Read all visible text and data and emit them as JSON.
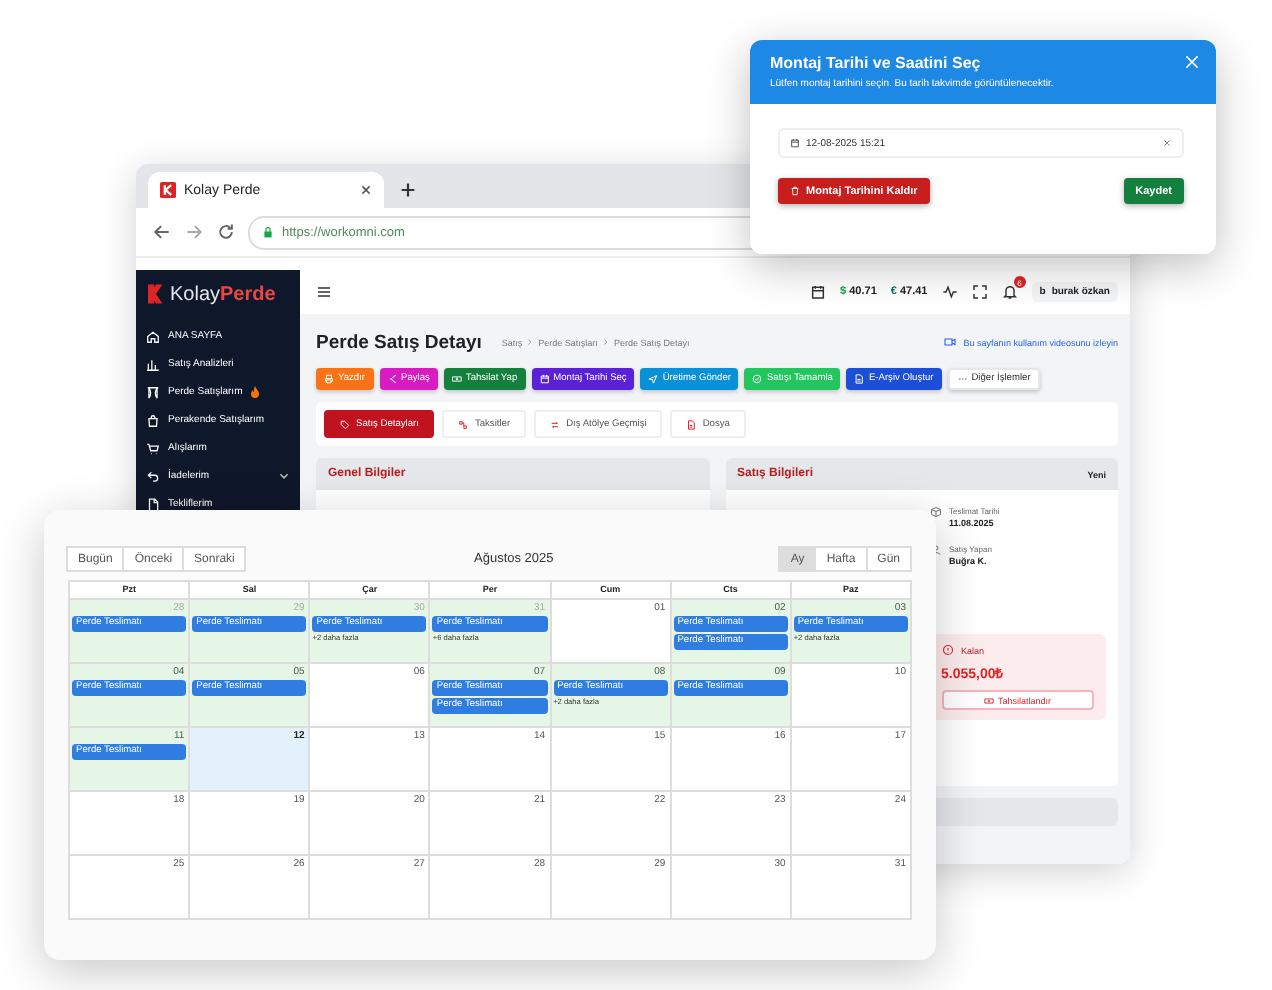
{
  "browser": {
    "tab_title": "Kolay Perde",
    "url": "https://workomni.com"
  },
  "app": {
    "logo": {
      "first": "Kolay",
      "second": "Perde"
    },
    "sidebar": [
      {
        "label": "ANA SAYFA",
        "hot": false,
        "expandable": false
      },
      {
        "label": "Satış Analizleri",
        "hot": false,
        "expandable": false
      },
      {
        "label": "Perde Satışlarım",
        "hot": true,
        "expandable": false
      },
      {
        "label": "Perakende Satışlarım",
        "hot": false,
        "expandable": false
      },
      {
        "label": "Alışlarım",
        "hot": false,
        "expandable": false
      },
      {
        "label": "İadelerim",
        "hot": false,
        "expandable": true
      },
      {
        "label": "Tekliflerim",
        "hot": false,
        "expandable": false
      }
    ],
    "topbar": {
      "currencies": [
        {
          "symbol": "$",
          "value": "40.71",
          "color": "#16a34a"
        },
        {
          "symbol": "€",
          "value": "47.41",
          "color": "#0f766e"
        }
      ],
      "notifications": "6",
      "user_initial": "b",
      "user_name": "burak özkan"
    },
    "page_title": "Perde Satış Detayı",
    "breadcrumb": [
      "Satış",
      "Perde Satışları",
      "Perde Satış Detayı"
    ],
    "video_link": "Bu sayfanın kullanım videosunu izleyin",
    "actions": [
      {
        "label": "Yazdır",
        "color": "#f97316"
      },
      {
        "label": "Paylaş",
        "color": "#d91bc2"
      },
      {
        "label": "Tahsilat Yap",
        "color": "#15803d"
      },
      {
        "label": "Montaj Tarihi Seç",
        "color": "#5b21d6"
      },
      {
        "label": "Üretime Gönder",
        "color": "#0891d8"
      },
      {
        "label": "Satışı Tamamla",
        "color": "#22c55e"
      },
      {
        "label": "E-Arşiv Oluştur",
        "color": "#1d4ed8"
      },
      {
        "label": "Diğer İşlemler",
        "color": "#ffffff"
      }
    ],
    "tabs": [
      {
        "label": "Satış Detayları",
        "selected": true
      },
      {
        "label": "Taksitler",
        "selected": false
      },
      {
        "label": "Dış Atölye Geçmişi",
        "selected": false
      },
      {
        "label": "Dosya",
        "selected": false
      }
    ],
    "general_panel": {
      "title": "Genel Bilgiler"
    },
    "sales_panel": {
      "title": "Satış Bilgileri",
      "status": "Yeni",
      "fields": [
        {
          "label": "Teslimat Tarihi",
          "value": "11.08.2025"
        },
        {
          "label": "Satış Yapan",
          "value": "Buğra K."
        }
      ],
      "balance": {
        "label": "Kalan",
        "amount": "5.055,00₺",
        "button": "Tahsilatlandır"
      }
    }
  },
  "calendar": {
    "nav": [
      "Bugün",
      "Önceki",
      "Sonraki"
    ],
    "title": "Ağustos 2025",
    "views": [
      {
        "label": "Ay",
        "selected": true
      },
      {
        "label": "Hafta",
        "selected": false
      },
      {
        "label": "Gün",
        "selected": false
      }
    ],
    "weekdays": [
      "Pzt",
      "Sal",
      "Çar",
      "Per",
      "Cum",
      "Cts",
      "Paz"
    ],
    "weeks": [
      [
        {
          "day": "28",
          "other_month": true,
          "highlighted": true,
          "today": false,
          "events": [
            "Perde Teslimatı"
          ]
        },
        {
          "day": "29",
          "other_month": true,
          "highlighted": true,
          "today": false,
          "events": [
            "Perde Teslimatı"
          ]
        },
        {
          "day": "30",
          "other_month": true,
          "highlighted": true,
          "today": false,
          "events": [
            "Perde Teslimatı"
          ],
          "more": "+2 daha fazla"
        },
        {
          "day": "31",
          "other_month": true,
          "highlighted": true,
          "today": false,
          "events": [
            "Perde Teslimatı"
          ],
          "more": "+6 daha fazla"
        },
        {
          "day": "01",
          "other_month": false,
          "highlighted": false,
          "today": false
        },
        {
          "day": "02",
          "other_month": false,
          "highlighted": true,
          "today": false,
          "events": [
            "Perde Teslimatı",
            "Perde Teslimatı"
          ]
        },
        {
          "day": "03",
          "other_month": false,
          "highlighted": true,
          "today": false,
          "events": [
            "Perde Teslimatı"
          ],
          "more": "+2 daha fazla"
        }
      ],
      [
        {
          "day": "04",
          "other_month": false,
          "highlighted": true,
          "today": false,
          "events": [
            "Perde Teslimatı"
          ]
        },
        {
          "day": "05",
          "other_month": false,
          "highlighted": true,
          "today": false,
          "events": [
            "Perde Teslimatı"
          ]
        },
        {
          "day": "06",
          "other_month": false,
          "highlighted": false,
          "today": false
        },
        {
          "day": "07",
          "other_month": false,
          "highlighted": true,
          "today": false,
          "events": [
            "Perde Teslimatı",
            "Perde Teslimatı"
          ]
        },
        {
          "day": "08",
          "other_month": false,
          "highlighted": true,
          "today": false,
          "events": [
            "Perde Teslimatı"
          ],
          "more": "+2 daha fazla"
        },
        {
          "day": "09",
          "other_month": false,
          "highlighted": true,
          "today": false,
          "events": [
            "Perde Teslimatı"
          ]
        },
        {
          "day": "10",
          "other_month": false,
          "highlighted": false,
          "today": false
        }
      ],
      [
        {
          "day": "11",
          "other_month": false,
          "highlighted": true,
          "today": false,
          "events": [
            "Perde Teslimatı"
          ]
        },
        {
          "day": "12",
          "other_month": false,
          "highlighted": false,
          "today": true
        },
        {
          "day": "13",
          "other_month": false,
          "highlighted": false,
          "today": false
        },
        {
          "day": "14",
          "other_month": false,
          "highlighted": false,
          "today": false
        },
        {
          "day": "15",
          "other_month": false,
          "highlighted": false,
          "today": false
        },
        {
          "day": "16",
          "other_month": false,
          "highlighted": false,
          "today": false
        },
        {
          "day": "17",
          "other_month": false,
          "highlighted": false,
          "today": false
        }
      ],
      [
        {
          "day": "18",
          "other_month": false,
          "highlighted": false,
          "today": false
        },
        {
          "day": "19",
          "other_month": false,
          "highlighted": false,
          "today": false
        },
        {
          "day": "20",
          "other_month": false,
          "highlighted": false,
          "today": false
        },
        {
          "day": "21",
          "other_month": false,
          "highlighted": false,
          "today": false
        },
        {
          "day": "22",
          "other_month": false,
          "highlighted": false,
          "today": false
        },
        {
          "day": "23",
          "other_month": false,
          "highlighted": false,
          "today": false
        },
        {
          "day": "24",
          "other_month": false,
          "highlighted": false,
          "today": false
        }
      ],
      [
        {
          "day": "25",
          "other_month": false,
          "highlighted": false,
          "today": false
        },
        {
          "day": "26",
          "other_month": false,
          "highlighted": false,
          "today": false
        },
        {
          "day": "27",
          "other_month": false,
          "highlighted": false,
          "today": false
        },
        {
          "day": "28",
          "other_month": false,
          "highlighted": false,
          "today": false
        },
        {
          "day": "29",
          "other_month": false,
          "highlighted": false,
          "today": false
        },
        {
          "day": "30",
          "other_month": false,
          "highlighted": false,
          "today": false
        },
        {
          "day": "31",
          "other_month": false,
          "highlighted": false,
          "today": false
        }
      ]
    ]
  },
  "modal": {
    "title": "Montaj Tarihi ve Saatini Seç",
    "subtitle": "Lütfen montaj tarihini seçin. Bu tarih takvimde görüntülenecektir.",
    "date_value": "12-08-2025 15:21",
    "remove_button": "Montaj Tarihini Kaldır",
    "save_button": "Kaydet"
  }
}
